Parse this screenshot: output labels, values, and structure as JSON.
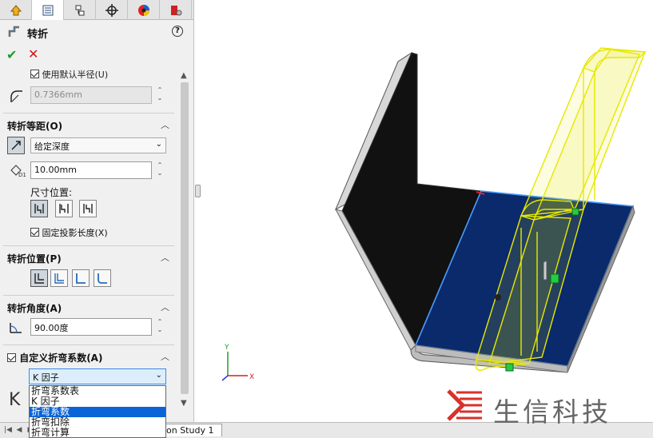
{
  "panel": {
    "title": "转折",
    "help": "?",
    "ok_icon": "✔",
    "cancel_icon": "✕",
    "use_default_radius": "使用默认半径(U)",
    "radius_value": "0.7366mm",
    "offset_section": "转折等距(O)",
    "end_condition": "给定深度",
    "distance_value": "10.00mm",
    "dimension_position_label": "尺寸位置:",
    "fix_projected_length": "固定投影长度(X)",
    "position_section": "转折位置(P)",
    "angle_section": "转折角度(A)",
    "angle_value": "90.00度",
    "custom_bend_section": "自定义折弯系数(A)",
    "bend_type_selected": "K 因子",
    "k_symbol": "K",
    "bend_options": [
      "折弯系数表",
      "K 因子",
      "折弯系数",
      "折弯扣除",
      "折弯计算"
    ],
    "selected_option_index": 2
  },
  "tabs": [
    "feature-manager-icon",
    "property-manager-icon",
    "configuration-manager-icon",
    "dimxpert-icon",
    "display-manager-icon",
    "appearance-icon"
  ],
  "graphics": {
    "study_tab": "on Study 1",
    "triad_x": "X",
    "triad_y": "Y"
  },
  "watermark": {
    "text": "生信科技",
    "logo_color": "#d9312b"
  },
  "colors": {
    "ok": "#1c9b2e",
    "cancel": "#d01616",
    "face_blue": "#0a2a6b",
    "edge_blue": "#4a9cff",
    "preview_yellow": "#e8e800",
    "handle_green": "#22cc44"
  }
}
